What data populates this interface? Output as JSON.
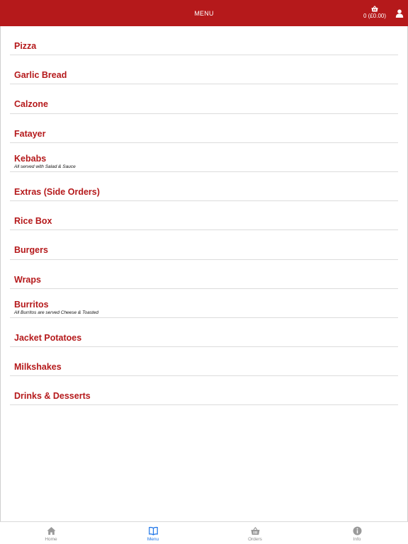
{
  "header": {
    "title": "MENU",
    "basket_text": "0 (£0.00)",
    "basket_icon": "basket-icon",
    "user_icon": "user-icon"
  },
  "menu": {
    "items": [
      {
        "label": "Pizza"
      },
      {
        "label": "Garlic Bread"
      },
      {
        "label": "Calzone"
      },
      {
        "label": "Fatayer"
      },
      {
        "label": "Kebabs",
        "sub": "All served with Salad & Sauce"
      },
      {
        "label": "Extras (Side Orders)"
      },
      {
        "label": "Rice Box"
      },
      {
        "label": "Burgers"
      },
      {
        "label": "Wraps"
      },
      {
        "label": "Burritos",
        "sub": "All Burritos are served Cheese & Toasted"
      },
      {
        "label": "Jacket Potatoes"
      },
      {
        "label": "Milkshakes"
      },
      {
        "label": "Drinks & Desserts"
      }
    ]
  },
  "tabbar": {
    "tabs": [
      {
        "label": "Home",
        "icon": "home-icon",
        "active": false
      },
      {
        "label": "Menu",
        "icon": "book-icon",
        "active": true
      },
      {
        "label": "Orders",
        "icon": "basket-icon",
        "active": false
      },
      {
        "label": "Info",
        "icon": "info-icon",
        "active": false
      }
    ]
  },
  "colors": {
    "brand": "#b5191b",
    "active_tab": "#1a73e8",
    "inactive_tab": "#8a8a8a"
  }
}
